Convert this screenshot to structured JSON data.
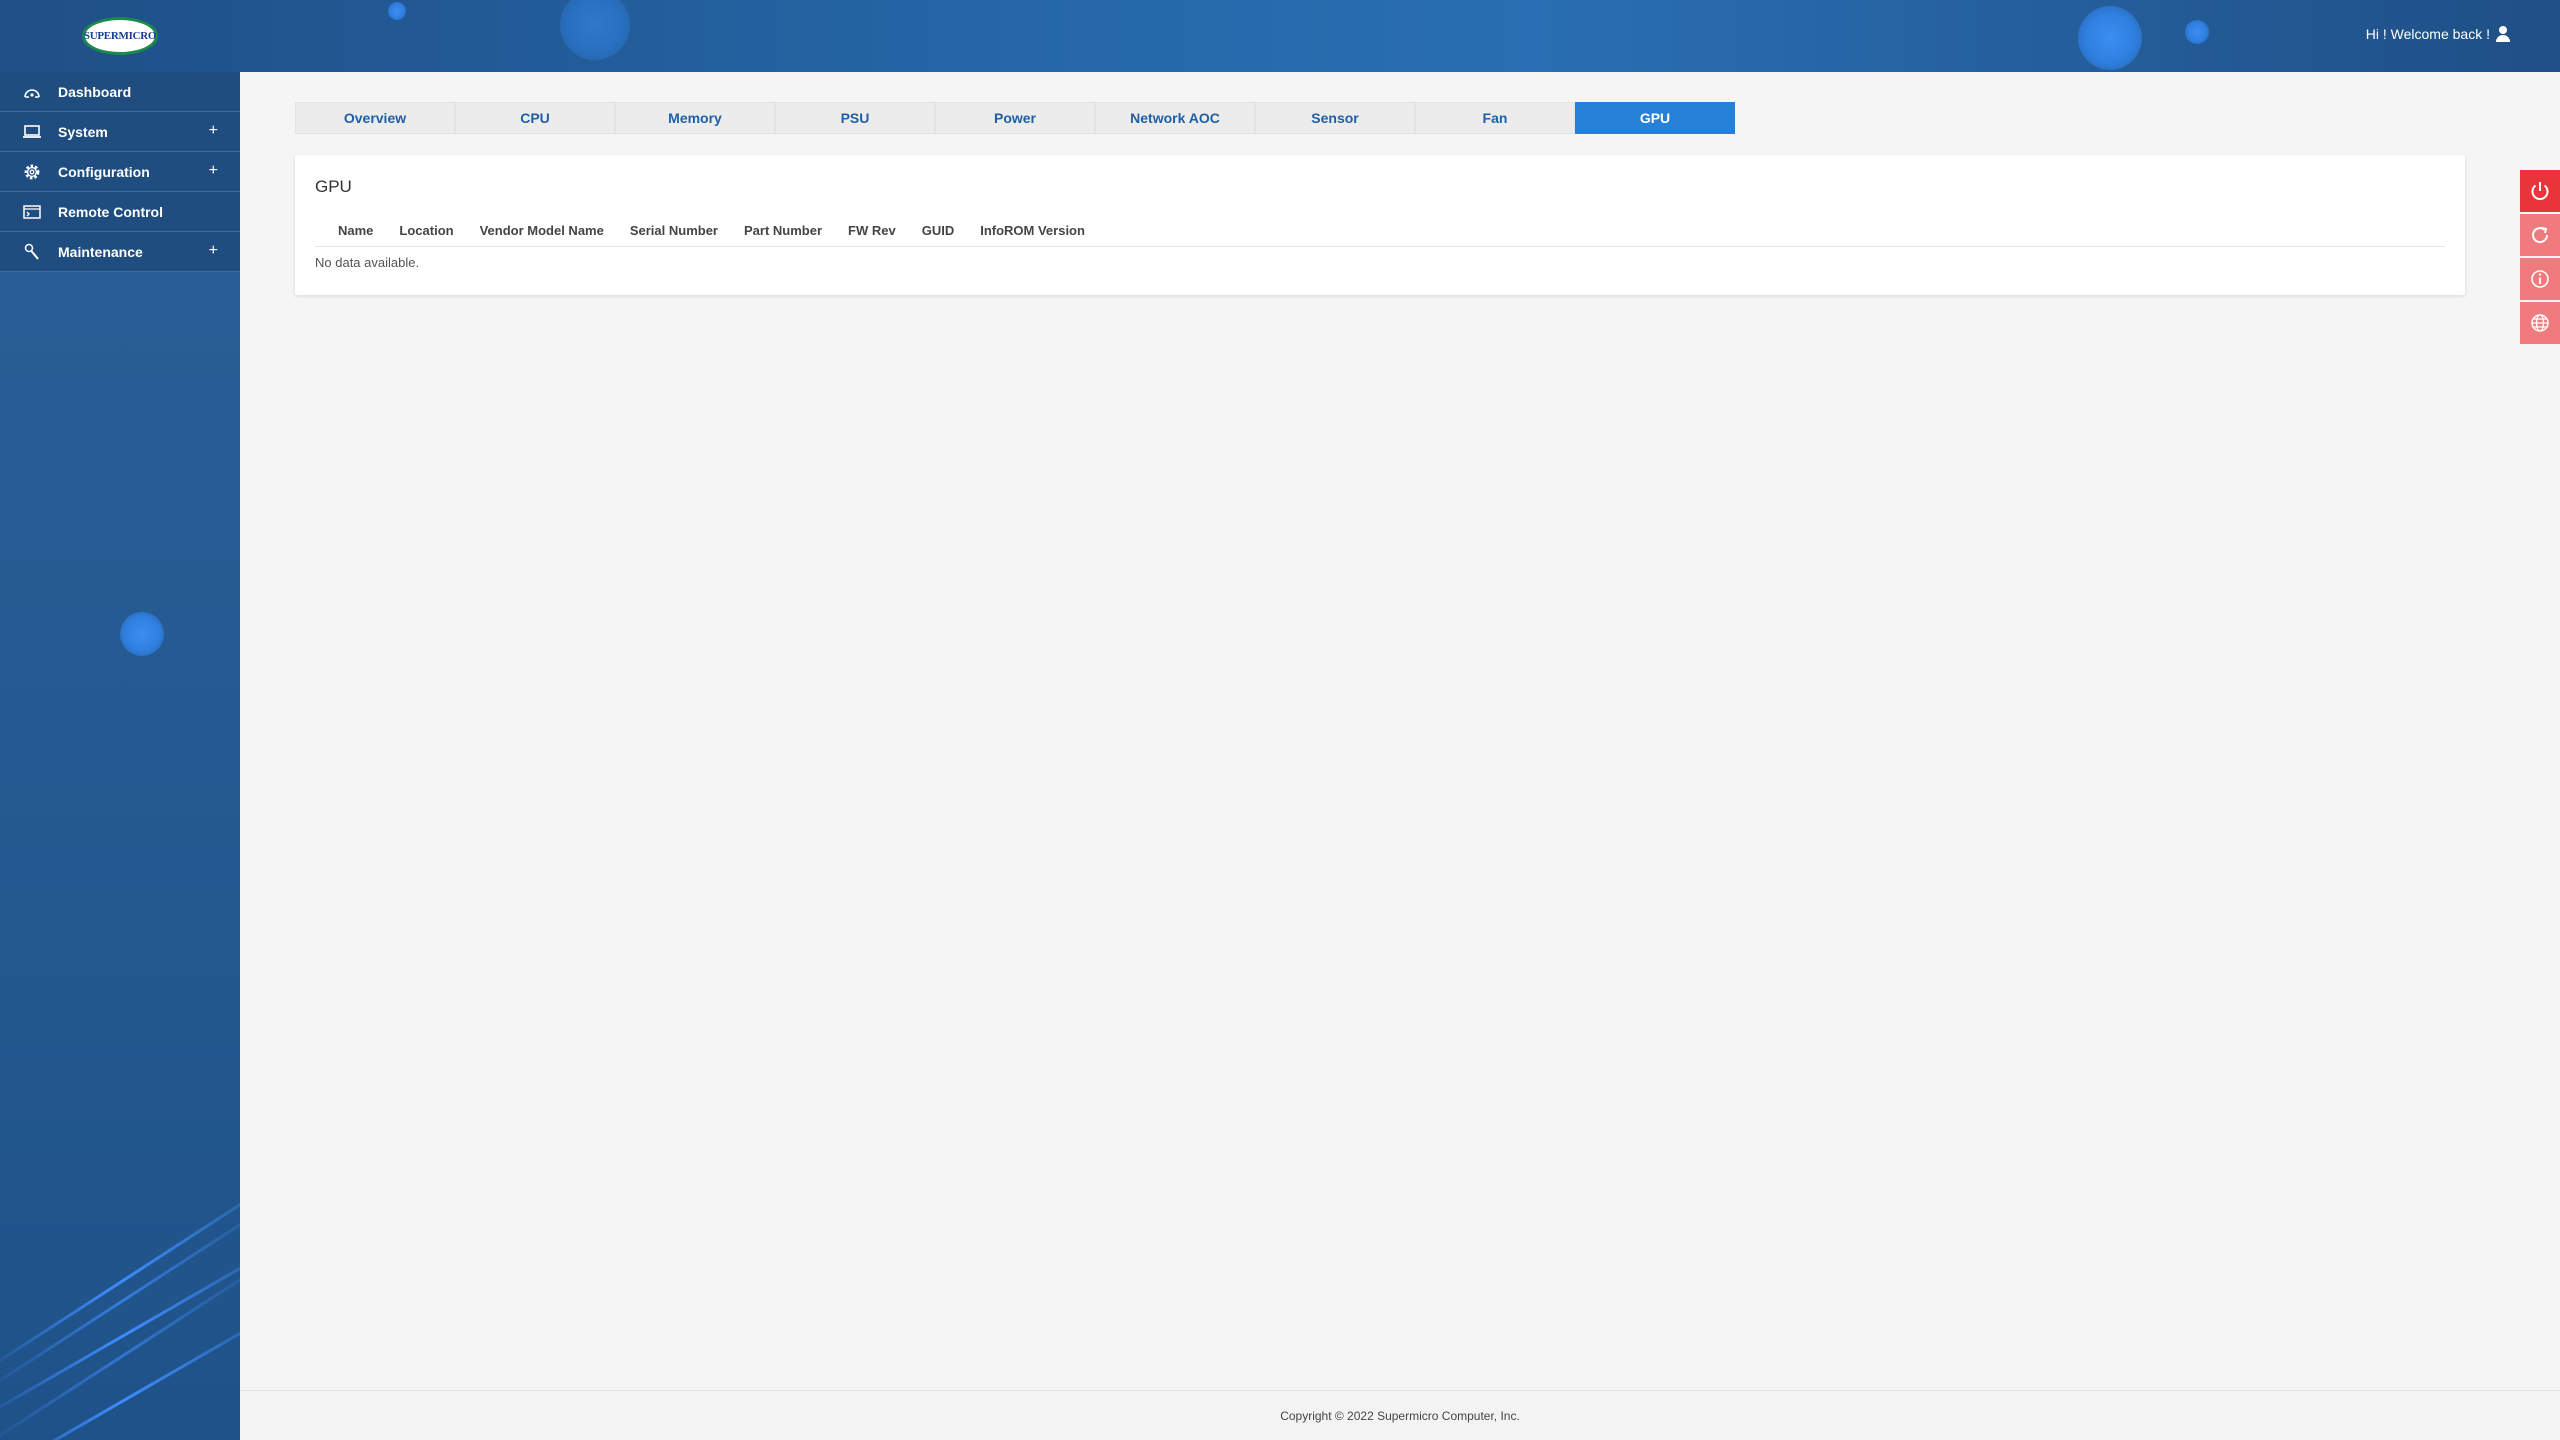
{
  "header": {
    "logo_text": "SUPERMICRO",
    "welcome": "Hi ! Welcome back !"
  },
  "sidebar": {
    "items": [
      {
        "label": "Dashboard",
        "icon": "dashboard-icon",
        "expandable": false
      },
      {
        "label": "System",
        "icon": "laptop-icon",
        "expandable": true
      },
      {
        "label": "Configuration",
        "icon": "gear-icon",
        "expandable": true
      },
      {
        "label": "Remote Control",
        "icon": "console-icon",
        "expandable": false
      },
      {
        "label": "Maintenance",
        "icon": "wrench-icon",
        "expandable": true
      }
    ],
    "expand_symbol": "+"
  },
  "tabs": [
    {
      "label": "Overview",
      "active": false
    },
    {
      "label": "CPU",
      "active": false
    },
    {
      "label": "Memory",
      "active": false
    },
    {
      "label": "PSU",
      "active": false
    },
    {
      "label": "Power",
      "active": false
    },
    {
      "label": "Network AOC",
      "active": false
    },
    {
      "label": "Sensor",
      "active": false
    },
    {
      "label": "Fan",
      "active": false
    },
    {
      "label": "GPU",
      "active": true
    }
  ],
  "card": {
    "title": "GPU",
    "columns": [
      "Name",
      "Location",
      "Vendor Model Name",
      "Serial Number",
      "Part Number",
      "FW Rev",
      "GUID",
      "InfoROM Version"
    ],
    "empty_text": "No data available."
  },
  "actions": [
    {
      "icon": "power-icon"
    },
    {
      "icon": "refresh-icon"
    },
    {
      "icon": "info-icon"
    },
    {
      "icon": "globe-icon"
    }
  ],
  "footer": {
    "copyright": "Copyright © 2022 Supermicro Computer, Inc."
  },
  "colors": {
    "accent": "#2680d8",
    "tab_text": "#1f5fa6",
    "danger": "#e8343a"
  }
}
